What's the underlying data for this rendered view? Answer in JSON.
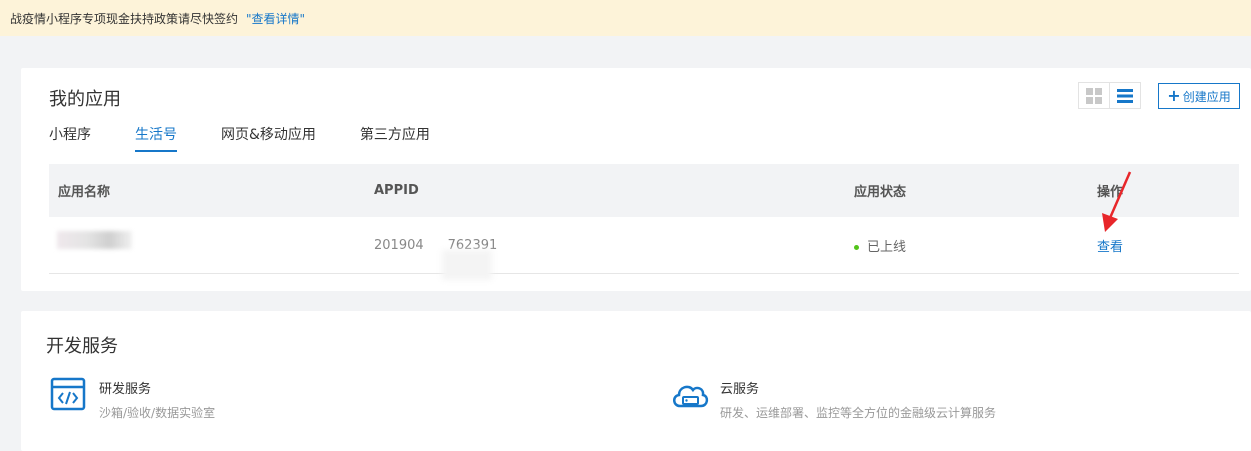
{
  "notice": {
    "text": "战疫情小程序专项现金扶持政策请尽快签约",
    "link": "\"查看详情\""
  },
  "apps": {
    "title": "我的应用",
    "create_label": "创建应用",
    "tabs": [
      {
        "label": "小程序",
        "active": false
      },
      {
        "label": "生活号",
        "active": true
      },
      {
        "label": "网页&移动应用",
        "active": false
      },
      {
        "label": "第三方应用",
        "active": false
      }
    ],
    "table": {
      "headers": [
        "应用名称",
        "APPID",
        "应用状态",
        "操作"
      ],
      "rows": [
        {
          "name": "",
          "appid_prefix": "201904",
          "appid_suffix": "762391",
          "status": "已上线",
          "action": "查看"
        }
      ]
    }
  },
  "dev": {
    "title": "开发服务",
    "services": [
      {
        "name": "研发服务",
        "desc": "沙箱/验收/数据实验室",
        "icon": "code-window-icon"
      },
      {
        "name": "云服务",
        "desc": "研发、运维部署、监控等全方位的金融级云计算服务",
        "icon": "cloud-server-icon"
      }
    ]
  },
  "colors": {
    "accent": "#1677c9",
    "notice_bg": "#fdf3d9",
    "status_online": "#52c41a",
    "annotation_arrow": "#e8262a"
  }
}
